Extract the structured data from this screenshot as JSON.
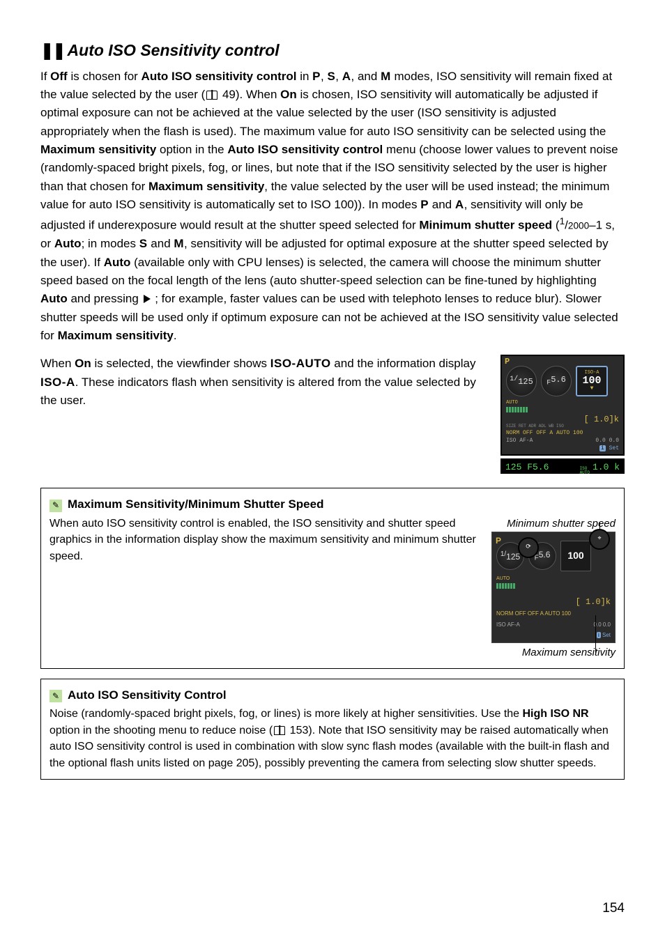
{
  "heading": {
    "squares": "❚❚",
    "text": "Auto ISO Sensitivity control"
  },
  "body1_parts": {
    "p1": "If ",
    "off": "Off",
    "p2": " is chosen for ",
    "autoctl": "Auto ISO sensitivity control",
    "p3": " in ",
    "modeP": "P",
    "modeS": "S",
    "modeA": "A",
    "modeM": "M",
    "p4": " modes, ISO sensitivity will remain fixed at the value selected by the user (",
    "ref49": " 49).  When ",
    "on": "On",
    "p5": " is chosen, ISO sensitivity will automatically be adjusted if optimal exposure can not be achieved at the value selected by the user (ISO sensitivity is adjusted appropriately when the flash is used).  The maximum value for auto ISO sensitivity can be selected using the ",
    "maxsens": "Maximum sensitivity",
    "p6": " option in the ",
    "p7": " menu (choose lower values to prevent noise (randomly-spaced bright pixels, fog, or lines, but note that if the ISO sensitivity selected by the user is higher than that chosen for ",
    "p8": ", the value selected by the user will be used instead; the minimum value for auto ISO sensitivity is automatically set to ISO 100)).  In modes ",
    "p9": " and ",
    "p10": ", sensitivity will only be adjusted if underexposure would result at the shutter speed selected for ",
    "minshut": "Minimum shutter speed",
    "p11": " (",
    "frac_num": "1",
    "frac_den": "2000",
    "p12": "–1 s, or ",
    "auto": "Auto",
    "p13": "; in modes ",
    "p14": ", sensitivity will be adjusted for optimal exposure at the shutter speed selected by the user).  If ",
    "p15": " (available only with CPU lenses) is selected, the camera will choose the minimum shutter speed based on the focal length of the lens (auto shutter-speed selection can be fine-tuned by highlighting ",
    "p16": " and pressing ",
    "p17": " ; for example, faster values can be used with telephoto lenses to reduce blur).  Slower shutter speeds will be used only if optimum exposure can not be achieved at the ISO sensitivity value selected for ",
    "p18": "."
  },
  "body2_parts": {
    "p1": "When ",
    "on": "On",
    "p2": " is selected, the viewfinder shows ",
    "isoauto": "ISO-AUTO",
    "p3": " and the information display ",
    "isoa": "ISO-A",
    "p4": ".  These indicators flash when sensitivity is altered from the value selected by the user."
  },
  "lcd": {
    "P": "P",
    "shutter_pre": "1/",
    "shutter": "125",
    "fnum_pre": "F",
    "fnum": "5.6",
    "iso_label": "ISO-A",
    "iso_val": "100",
    "bracket": "[   1.0]k",
    "row_labels": "NORM      OFF   OFF        A   AUTO   100",
    "row_labels_top": "SIZE         RET        ADR         ADL          WB          ISO",
    "row2": "ISO   AF-A",
    "row2b": "0.0      0.0",
    "set": "Set"
  },
  "vf": {
    "left": "125  F5.6",
    "right_a": "ISO",
    "right_b": "AUTO",
    "right_c": "1.0 k"
  },
  "callout1": {
    "title": "Maximum Sensitivity/Minimum Shutter Speed",
    "body": "When auto ISO sensitivity control is enabled, the ISO sensitivity and shutter speed graphics in the information display show the maximum sensitivity and minimum shutter speed.",
    "top_label": "Minimum shutter speed",
    "bot_label": "Maximum sensitivity"
  },
  "lcd2": {
    "P": "P",
    "shutter_pre": "1/",
    "shutter": "125",
    "fnum_pre": "F",
    "fnum": "5.6",
    "iso": "100",
    "bracket": "[   1.0]k",
    "row_labels": "NORM      OFF   OFF        A   AUTO   100",
    "row2": "ISO   AF-A",
    "row2b": "0.0      0.0",
    "set": "Set"
  },
  "callout2": {
    "title": "Auto ISO Sensitivity Control",
    "b1": "Noise (randomly-spaced bright pixels, fog, or lines) is more likely at higher sensitivities.  Use the ",
    "highisonr": "High ISO NR",
    "b2": " option in the shooting menu to reduce noise (",
    "ref153": " 153).  Note that ISO sensitivity may be raised automatically when auto ISO sensitivity control is used in combination with slow sync flash modes (available with the built-in flash and the optional flash units listed on page 205), possibly preventing the camera from selecting slow shutter speeds."
  },
  "page_number": "154"
}
